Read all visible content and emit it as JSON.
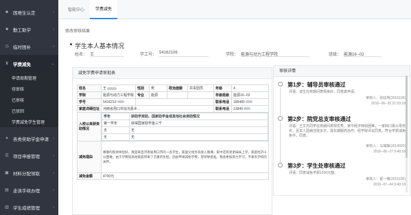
{
  "sidebar": {
    "items": [
      {
        "label": "困难生认定",
        "icon": "person-icon"
      },
      {
        "label": "勤工助学",
        "icon": "briefcase-icon"
      },
      {
        "label": "临时困补",
        "icon": "clock-icon"
      },
      {
        "label": "学费减免",
        "icon": "yen-icon",
        "active": true
      }
    ],
    "subitems": [
      "申请周期管理",
      "待审核",
      "已审核",
      "已驳回",
      "学费减免学生管理"
    ],
    "more": [
      {
        "label": "各类奖助学金申请",
        "icon": "award-icon"
      },
      {
        "label": "项目申报管理",
        "icon": "list-icon"
      },
      {
        "label": "材料分配领取",
        "icon": "box-icon"
      },
      {
        "label": "走读手续办理",
        "icon": "doc-icon"
      },
      {
        "label": "学生成绩管理",
        "icon": "chart-icon"
      }
    ]
  },
  "topbar": {
    "tabs": [
      "智能中心",
      "学费减免"
    ]
  },
  "breadcrumb": "修改审核结果",
  "header": {
    "title": "学生本人基本情况",
    "name_label": "姓名：",
    "name_value": "王",
    "id_label": "学工号：",
    "id_value": "54162106",
    "college_label": "学院：",
    "college_value": "能源与动力工程学院",
    "class_label": "班级：",
    "class_value": "能源16--02"
  },
  "application": {
    "panel_title": "减免学费申请审批表",
    "rows": {
      "name_k": "姓名",
      "name_v": "王",
      "gender_k": "性别",
      "gender_v": "男",
      "politics_k": "政治面貌",
      "politics_v": "共青团员",
      "grade_k": "年级",
      "grade_v": "4",
      "college_k": "学院",
      "college_v": "能源与动力工程学院",
      "major_k": "专业",
      "major_v": "能源",
      "class_k": "年级班级",
      "class_v": "能源16--02",
      "sid_k": "学号",
      "sid_v": "5416210",
      "phone_k": "联系电话",
      "phone_v": "186480",
      "addr_k": "家庭详细住址",
      "addr_v": "河南省周口市扶沟县乡...",
      "contact_k": "联系电话",
      "contact_v": "13849",
      "aid_k": "入校以来获资助情况",
      "aid_h1": "学年",
      "aid_h2": "获助学资助、国家助学金或其他社会资助情况",
      "aid_r1a": "第一学年",
      "aid_r1b": "获得国家助学金三千",
      "aid_r2a": "无",
      "aid_r2b": "无",
      "aid_r3a": "无",
      "aid_r3b": "无",
      "reason_k": "减免理由",
      "reason_v": "尊敬的院领导您好，我是来自河南省周口市的一名学生，家里父母务农收入微薄，家中还有弟弟妹妹上学，家庭经济十分困难。由于学费较高给家庭带来了沉重的负担，因此申请减免学费，望领导批准。我会更加努力学习，不辜负学校的关怀。",
      "amount_k": "减免金额",
      "amount_v": "4700元"
    }
  },
  "bottom": {
    "amount_label": "减免金额",
    "amount_value": "4700元"
  },
  "review": {
    "panel_title": "审核详情",
    "steps": [
      {
        "title": "第1步：辅导员审核通过",
        "comment": "评语：该生在校期间表现良好，同意其申请。",
        "reviewer": "审核人：张廷熊(2016106)",
        "date": "2016--06--25 21:53:18"
      },
      {
        "title": "第2步：院党总支审核通过",
        "comment": "评语：王文杰同学在校期间表现优秀，家中经济特别困难，一家四口靠父母务农，且本人因病住院多次，需长期服药治疗。经学院评议同意。符合学费减免条件，同意。",
        "reviewer": "审核人：马瑞静(2014020)",
        "date": "2016--06--27 9:40:18"
      },
      {
        "title": "第3步：学生处审核通过",
        "comment": "评语：同意减免学费1200元整。",
        "reviewer": "审核人：翟一楠(2016106)",
        "date": "2016--07--04 9:40:18"
      }
    ]
  },
  "colors": {
    "sidebar_bg": "#30353f",
    "accent": "#2d8cf0",
    "link": "#4fa3ff"
  }
}
